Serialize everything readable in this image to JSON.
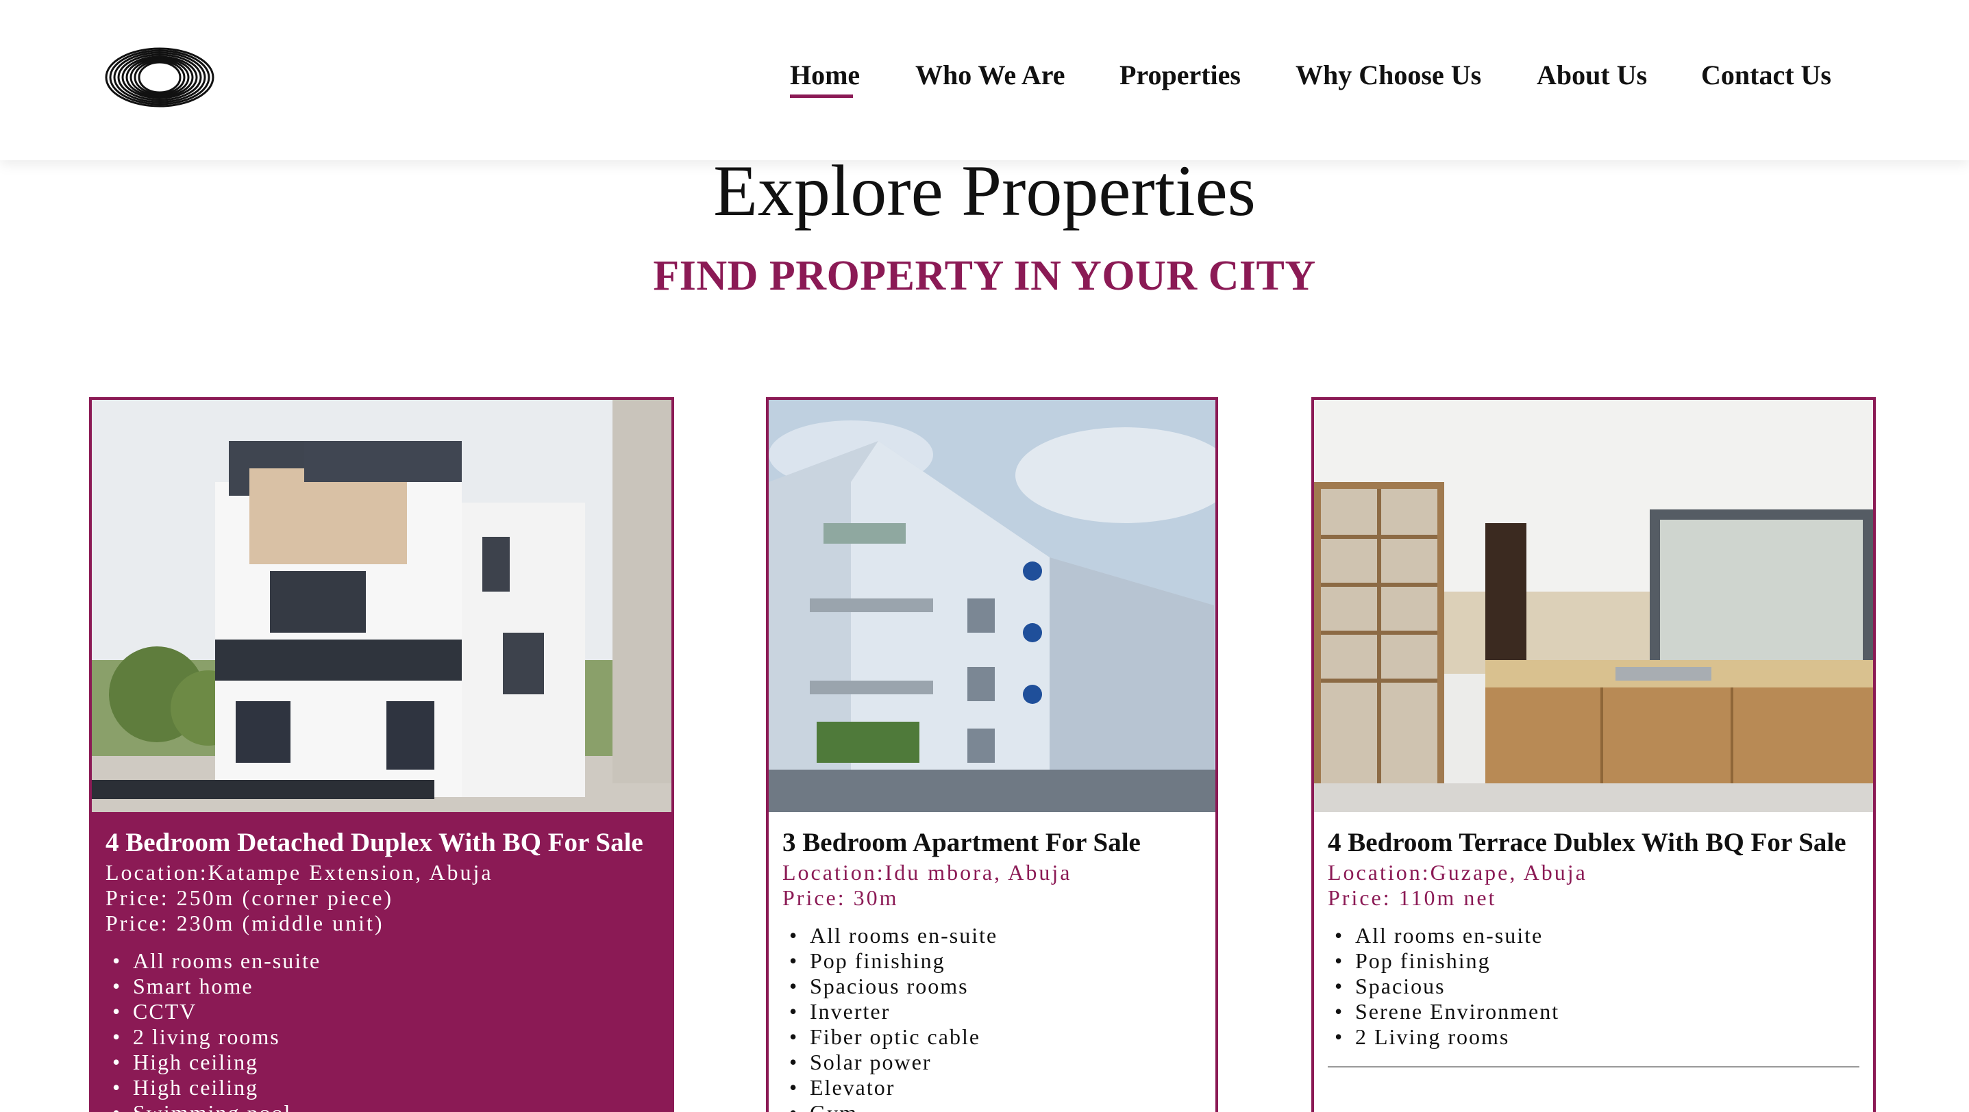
{
  "nav": {
    "items": [
      "Home",
      "Who We Are",
      "Properties",
      "Why Choose Us",
      "About Us",
      "Contact Us"
    ],
    "active": "Home"
  },
  "page": {
    "title": "Explore Properties",
    "subtitle": "FIND PROPERTY IN YOUR CITY"
  },
  "colors": {
    "accent": "#8b1a55",
    "text": "#111111",
    "background": "#ffffff"
  },
  "icons": {
    "logo": "concentric-rings-logo"
  },
  "properties": [
    {
      "title": "4 Bedroom Detached Duplex With BQ For Sale",
      "location": "Location:Katampe Extension, Abuja",
      "prices": [
        "Price: 250m (corner piece)",
        "Price: 230m (middle unit)"
      ],
      "features": [
        "All rooms en-suite",
        "Smart home",
        "CCTV",
        "2 living rooms",
        "High ceiling",
        "High ceiling",
        "Swimming pool"
      ],
      "featured": true
    },
    {
      "title": "3 Bedroom Apartment For Sale",
      "location": "Location:Idu mbora, Abuja",
      "prices": [
        "Price: 30m"
      ],
      "features": [
        "All rooms en-suite",
        "Pop finishing",
        "Spacious rooms",
        "Inverter",
        "Fiber optic cable",
        "Solar power",
        "Elevator",
        "Gym"
      ],
      "featured": false
    },
    {
      "title": "4 Bedroom Terrace Dublex With BQ For Sale",
      "location": "Location:Guzape, Abuja",
      "prices": [
        "Price: 110m net"
      ],
      "features": [
        "All rooms en-suite",
        "Pop finishing",
        "Spacious",
        "Serene Environment",
        "2 Living rooms"
      ],
      "featured": false
    }
  ]
}
